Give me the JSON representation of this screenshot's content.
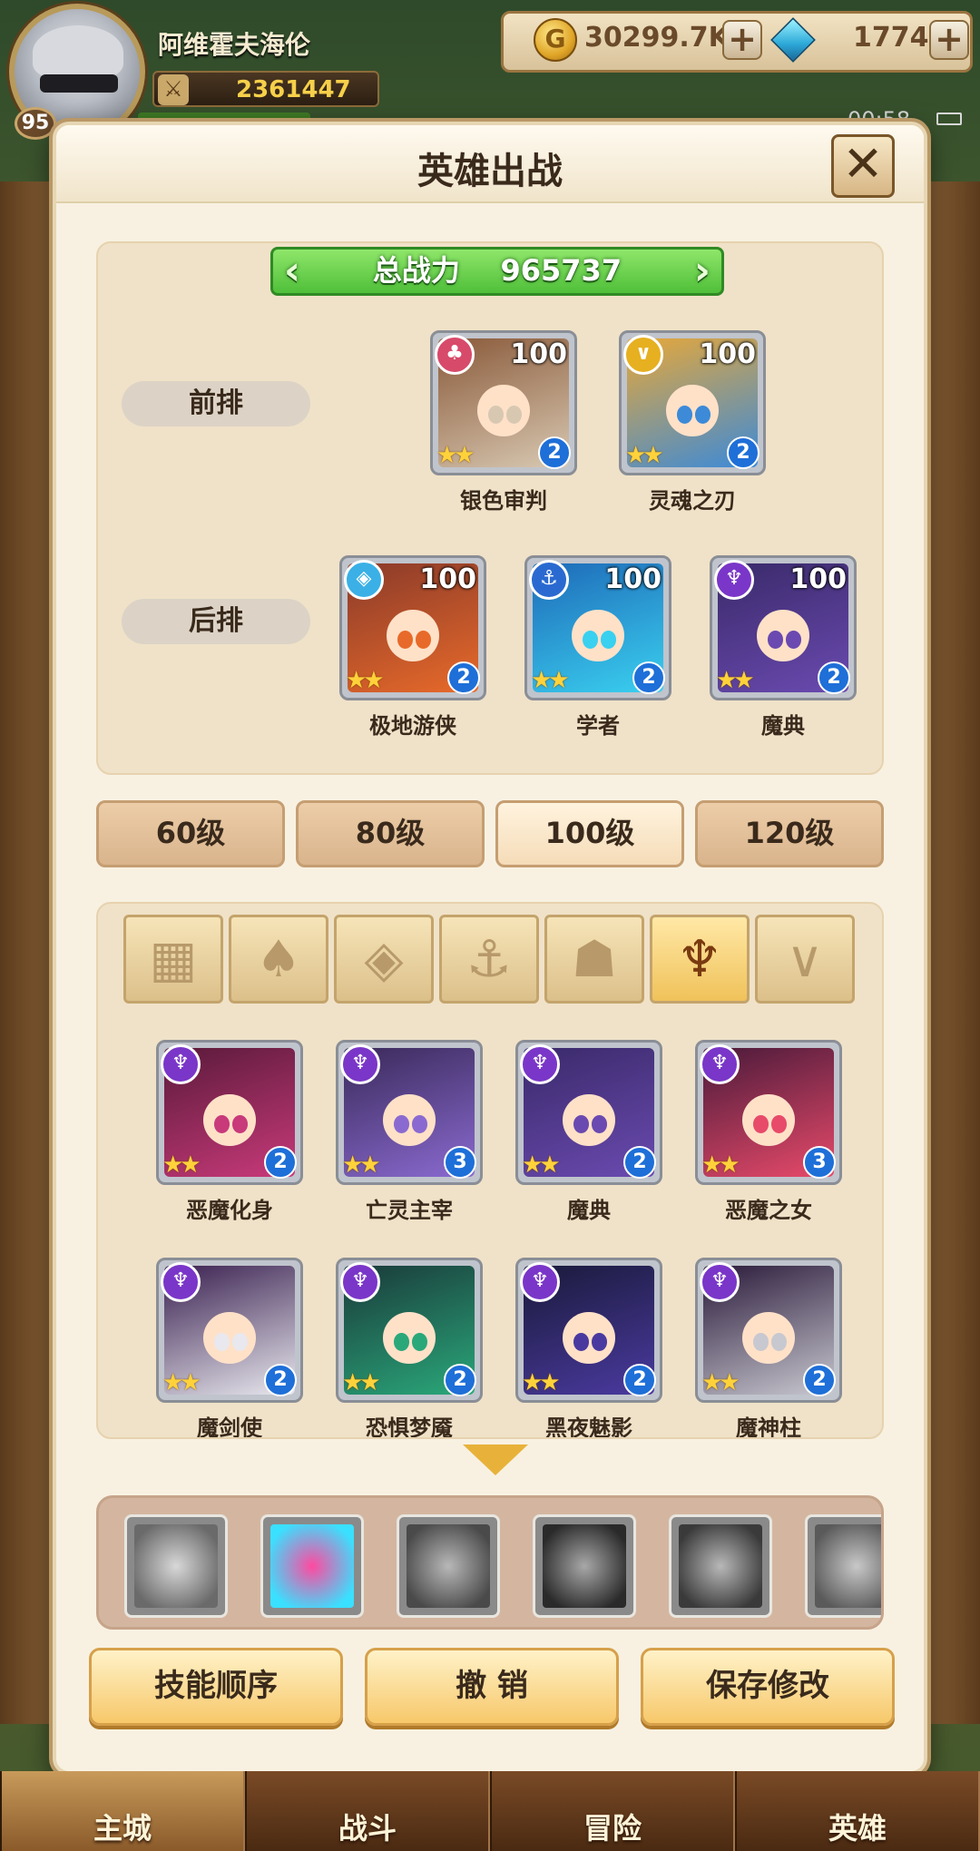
{
  "player": {
    "name": "阿维霍夫海伦",
    "level": "95",
    "power": "2361447"
  },
  "resources": {
    "gold": "30299.7K",
    "gems": "1774"
  },
  "status": {
    "time": "00:58"
  },
  "dialog": {
    "title": "英雄出战",
    "total_power_label": "总战力",
    "total_power": "965737",
    "front_row_label": "前排",
    "back_row_label": "后排"
  },
  "formation": {
    "front": [
      {
        "name": "银色审判",
        "level": "100",
        "stars": "★★",
        "rank": "2",
        "faction": "red",
        "faction_icon": "leaf-icon",
        "art": [
          "#8a5a3a",
          "#d8c8b2"
        ]
      },
      {
        "name": "灵魂之刃",
        "level": "100",
        "stars": "★★",
        "rank": "2",
        "faction": "gold",
        "faction_icon": "chevron-icon",
        "art": [
          "#e8a838",
          "#3c8ad8"
        ]
      }
    ],
    "back": [
      {
        "name": "极地游侠",
        "level": "100",
        "stars": "★★",
        "rank": "2",
        "faction": "blue",
        "faction_icon": "diamond-icon",
        "art": [
          "#8a3a2a",
          "#e86a2a"
        ]
      },
      {
        "name": "学者",
        "level": "100",
        "stars": "★★",
        "rank": "2",
        "faction": "navy",
        "faction_icon": "anchor-icon",
        "art": [
          "#1e6ab8",
          "#3ad0f0"
        ]
      },
      {
        "name": "魔典",
        "level": "100",
        "stars": "★★",
        "rank": "2",
        "faction": "purple",
        "faction_icon": "demon-icon",
        "art": [
          "#3a2a6a",
          "#6a4ab0"
        ]
      }
    ]
  },
  "level_tabs": [
    "60级",
    "80级",
    "100级",
    "120级"
  ],
  "level_tab_active": 2,
  "filters": [
    {
      "icon": "grid-icon",
      "glyph": "▦"
    },
    {
      "icon": "leaf-faction-icon",
      "glyph": "♠"
    },
    {
      "icon": "diamond-faction-icon",
      "glyph": "◈"
    },
    {
      "icon": "anchor-faction-icon",
      "glyph": "⚓"
    },
    {
      "icon": "beast-faction-icon",
      "glyph": "☗"
    },
    {
      "icon": "demon-faction-icon",
      "glyph": "♆"
    },
    {
      "icon": "chevron-faction-icon",
      "glyph": "∨"
    }
  ],
  "filter_active": 5,
  "roster": [
    {
      "name": "恶魔化身",
      "stars": "★★",
      "rank": "2",
      "art": [
        "#5a1a3a",
        "#c83a7a"
      ]
    },
    {
      "name": "亡灵主宰",
      "stars": "★★",
      "rank": "3",
      "art": [
        "#3a2a5a",
        "#8a6ad0"
      ]
    },
    {
      "name": "魔典",
      "stars": "★★",
      "rank": "2",
      "art": [
        "#3a2a6a",
        "#6a4ab0"
      ]
    },
    {
      "name": "恶魔之女",
      "stars": "★★",
      "rank": "3",
      "art": [
        "#4a1a3a",
        "#e84a6a"
      ]
    },
    {
      "name": "魔剑使",
      "stars": "★★",
      "rank": "2",
      "art": [
        "#3a2050",
        "#e8e8ee"
      ]
    },
    {
      "name": "恐惧梦魇",
      "stars": "★★",
      "rank": "2",
      "art": [
        "#1a3a3a",
        "#2aa87a"
      ]
    },
    {
      "name": "黑夜魅影",
      "stars": "★★",
      "rank": "2",
      "art": [
        "#1a1a3a",
        "#4a3aa0"
      ]
    },
    {
      "name": "魔神柱",
      "stars": "★★",
      "rank": "2",
      "art": [
        "#2a1a3a",
        "#c8c8d0"
      ]
    }
  ],
  "skills": [
    {
      "icon": "wing-skill-icon",
      "colors": [
        "#d8d8d8",
        "#6a6a6a"
      ]
    },
    {
      "icon": "burst-skill-icon",
      "colors": [
        "#ff4aa0",
        "#3ae0ff"
      ]
    },
    {
      "icon": "shield-skill-icon",
      "colors": [
        "#b8b8b8",
        "#4a4a4a"
      ]
    },
    {
      "icon": "wave-skill-icon",
      "colors": [
        "#a8a8a8",
        "#2a2a2a"
      ]
    },
    {
      "icon": "shield-skill-icon",
      "colors": [
        "#b8b8b8",
        "#3a3a3a"
      ]
    },
    {
      "icon": "claw-skill-icon",
      "colors": [
        "#c8c8c8",
        "#5a5a5a"
      ]
    }
  ],
  "actions": {
    "skill_order": "技能顺序",
    "undo": "撤 销",
    "save": "保存修改"
  },
  "nav": [
    "主城",
    "战斗",
    "冒险",
    "英雄"
  ]
}
